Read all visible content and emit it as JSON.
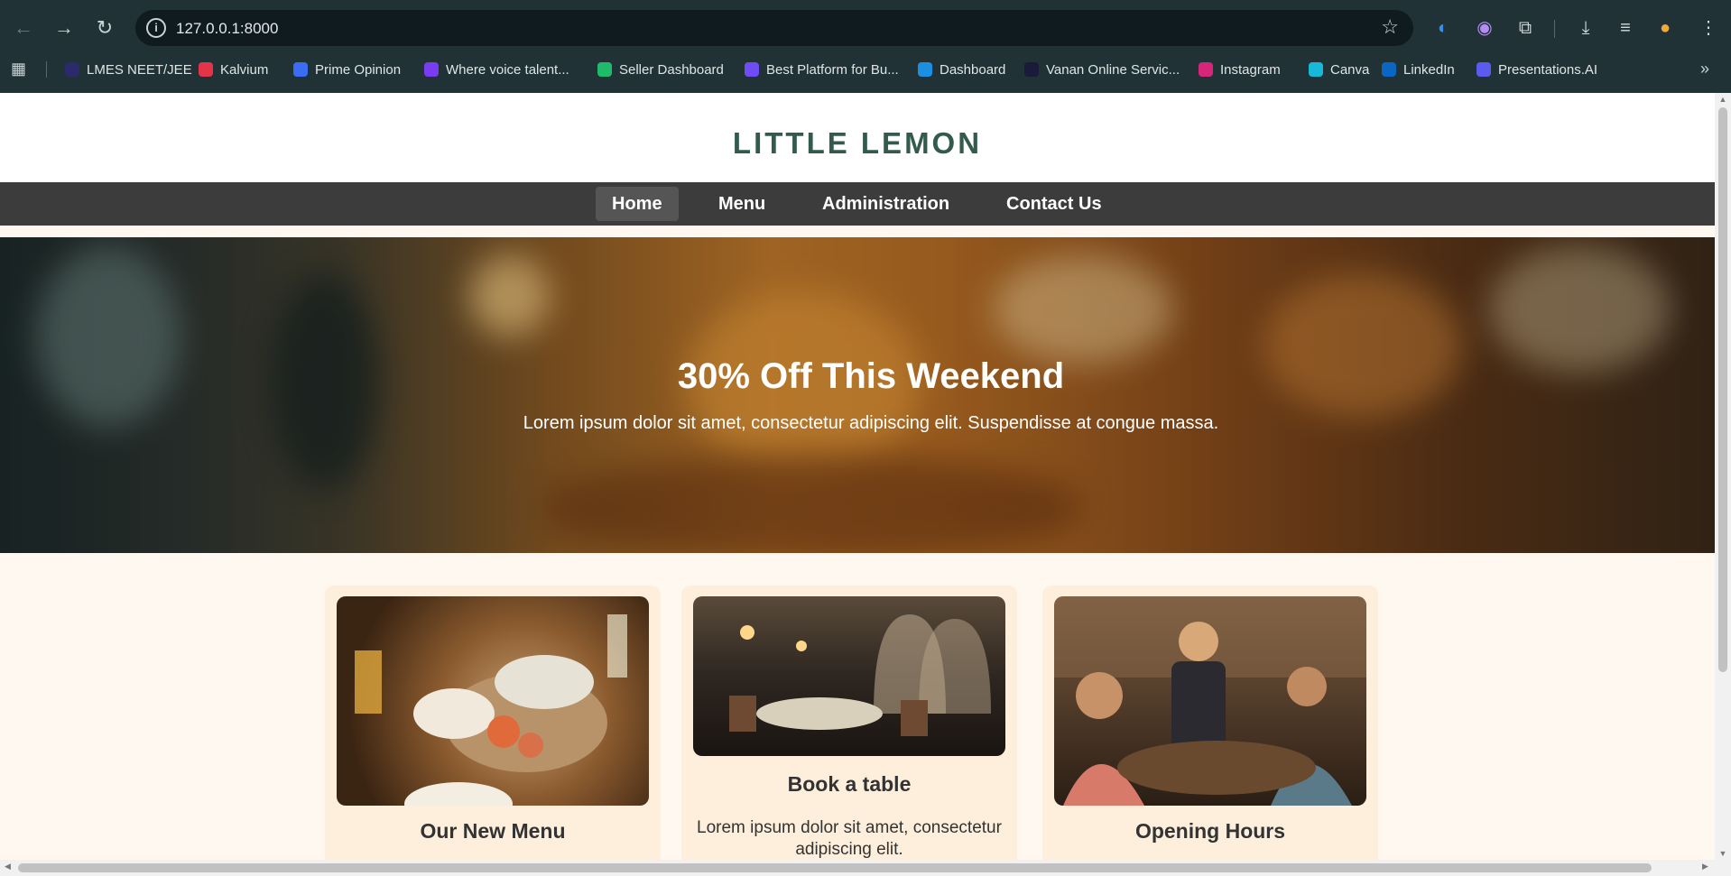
{
  "browser": {
    "url": "127.0.0.1:8000",
    "bookmarks": [
      {
        "label": "LMES NEET/JEE",
        "icon": "lmes-icon",
        "color": "#2b2b6b"
      },
      {
        "label": "Kalvium",
        "icon": "kalvium-icon",
        "color": "#e3344a"
      },
      {
        "label": "Prime Opinion",
        "icon": "prime-opinion-icon",
        "color": "#3a6cf4"
      },
      {
        "label": "Where voice talent...",
        "icon": "voice-icon",
        "color": "#7a3cf0"
      },
      {
        "label": "Seller Dashboard",
        "icon": "seller-icon",
        "color": "#1ebc6a"
      },
      {
        "label": "Best Platform for Bu...",
        "icon": "platform-icon",
        "color": "#6f4cf5"
      },
      {
        "label": "Dashboard",
        "icon": "dashboard-icon",
        "color": "#1d8fe0"
      },
      {
        "label": "Vanan Online Servic...",
        "icon": "vanan-icon",
        "color": "#1a1a3a"
      },
      {
        "label": "Instagram",
        "icon": "instagram-icon",
        "color": "#d6267a"
      },
      {
        "label": "Canva",
        "icon": "canva-icon",
        "color": "#17b8d8"
      },
      {
        "label": "LinkedIn",
        "icon": "linkedin-icon",
        "color": "#0a66c2"
      },
      {
        "label": "Presentations.AI",
        "icon": "presentations-icon",
        "color": "#5b5bf0"
      }
    ]
  },
  "site": {
    "logo": "LITTLE LEMON",
    "nav": [
      {
        "label": "Home",
        "active": true
      },
      {
        "label": "Menu",
        "active": false
      },
      {
        "label": "Administration",
        "active": false
      },
      {
        "label": "Contact Us",
        "active": false
      }
    ],
    "hero": {
      "title": "30% Off This Weekend",
      "text": "Lorem ipsum dolor sit amet, consectetur adipiscing elit. Suspendisse at congue massa."
    },
    "cards": [
      {
        "title": "Our New Menu",
        "text": ""
      },
      {
        "title": "Book a table",
        "text": "Lorem ipsum dolor sit amet, consectetur adipiscing elit."
      },
      {
        "title": "Opening Hours",
        "text": ""
      }
    ]
  }
}
